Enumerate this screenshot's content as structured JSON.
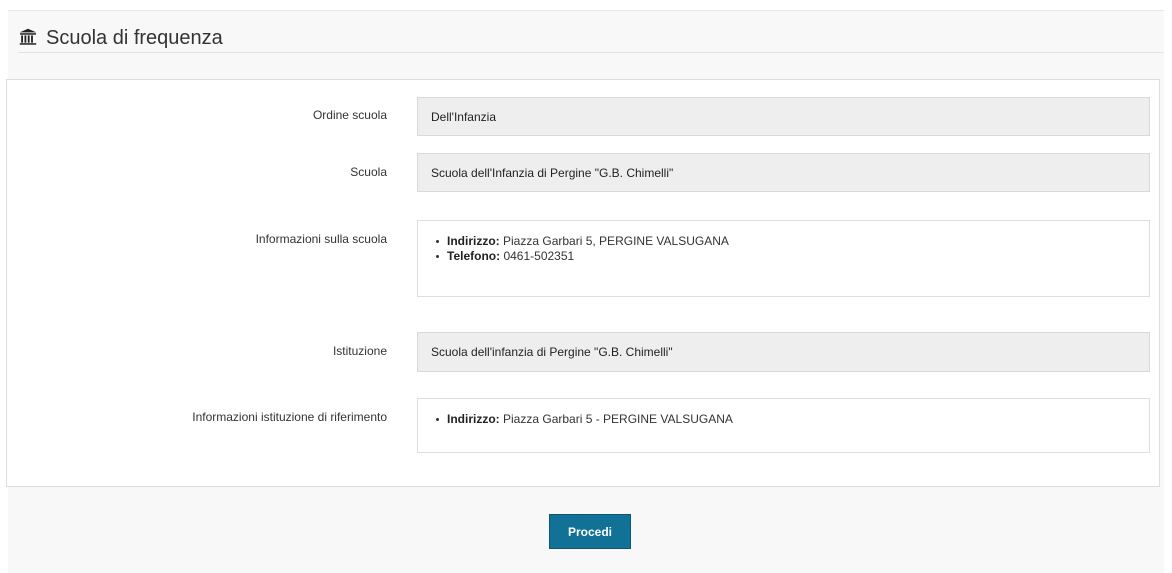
{
  "section": {
    "title": "Scuola di frequenza",
    "icon": "institution-icon"
  },
  "form": {
    "ordine_scuola": {
      "label": "Ordine scuola",
      "value": "Dell'Infanzia"
    },
    "scuola": {
      "label": "Scuola",
      "value": "Scuola dell'Infanzia di Pergine  \"G.B. Chimelli\""
    },
    "informazioni_scuola": {
      "label": "Informazioni sulla scuola",
      "items": [
        {
          "key": "Indirizzo:",
          "value": "Piazza Garbari 5, PERGINE VALSUGANA"
        },
        {
          "key": "Telefono:",
          "value": "0461-502351"
        }
      ]
    },
    "istituzione": {
      "label": "Istituzione",
      "value": "Scuola dell'infanzia di Pergine  \"G.B. Chimelli\""
    },
    "informazioni_istituzione": {
      "label": "Informazioni istituzione di riferimento",
      "items": [
        {
          "key": "Indirizzo:",
          "value": "Piazza Garbari 5 - PERGINE VALSUGANA"
        }
      ]
    }
  },
  "actions": {
    "procedi_label": "Procedi"
  },
  "colors": {
    "page_background": "#f8f8f8",
    "panel_border": "#dddddd",
    "field_background": "#eeeeee",
    "button_background": "#127196",
    "button_text": "#ffffff",
    "text": "#333333"
  }
}
